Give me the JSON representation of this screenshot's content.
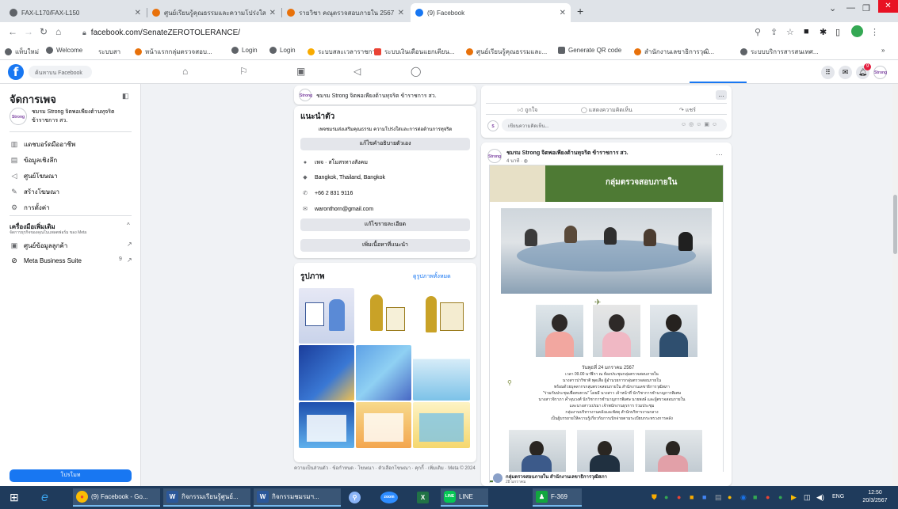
{
  "browser": {
    "tabs": [
      {
        "label": "FAX-L170/FAX-L150",
        "color": "#5f6368",
        "active": false
      },
      {
        "label": "ศูนย์เรียนรู้คุณธรรมและความโปร่งใส...",
        "color": "#e8710a",
        "active": false
      },
      {
        "label": "รายวิชา คณุตรวจสอบภายใน 2567",
        "color": "#e8710a",
        "active": false
      },
      {
        "label": "(9) Facebook",
        "color": "#1877f2",
        "active": true
      }
    ],
    "new_tab": "+",
    "url": "facebook.com/SenateZEROTOLERANCE/",
    "bookmarks": [
      {
        "label": "แท็บใหม่",
        "color": "#5f6368"
      },
      {
        "label": "Welcome",
        "color": "#5f6368"
      },
      {
        "label": "ระบบสา",
        "color": "#9aa0a6"
      },
      {
        "label": "หน้าแรกกลุ่มตรวจสอบ...",
        "color": "#e8710a"
      },
      {
        "label": "Login",
        "color": "#5f6368"
      },
      {
        "label": "Login",
        "color": "#5f6368"
      },
      {
        "label": "ระบบสละเวลาราชการ",
        "color": "#f9ab00"
      },
      {
        "label": "ระบบเงินเดือนแยกเตียน...",
        "color": "#ea4335"
      },
      {
        "label": "ศูนย์เรียนรู้คุณธรรมและ...",
        "color": "#e8710a"
      },
      {
        "label": "Generate QR code",
        "color": "#5f6368"
      },
      {
        "label": "สำนักงานเลขาธิการวุฒิ...",
        "color": "#e8710a"
      },
      {
        "label": "ระบบบริการสารสนเทศ...",
        "color": "#5f6368"
      }
    ],
    "more_bookmarks": "»"
  },
  "facebook": {
    "search_placeholder": "ค้นหาบน Facebook",
    "notif_count": "9",
    "sidebar": {
      "title": "จัดการเพจ",
      "page_name": "ชมรม Strong จิตพอเพียงต้านทุจริต ข้าราชการ สว.",
      "items": [
        {
          "label": "แดชบอร์ดมืออาชีพ",
          "icon": "dashboard-icon"
        },
        {
          "label": "ข้อมูลเชิงลึก",
          "icon": "insights-icon"
        },
        {
          "label": "ศูนย์โฆษณา",
          "icon": "megaphone-icon"
        },
        {
          "label": "สร้างโฆษณา",
          "icon": "create-ad-icon"
        },
        {
          "label": "การตั้งค่า",
          "icon": "gear-icon"
        }
      ],
      "tools_title": "เครื่องมือเพิ่มเติม",
      "tools_subtitle": "จัดการธุรกิจของคุณในแพลตฟอร์ม ของ Meta",
      "tools": [
        {
          "label": "ศูนย์ข้อมูลลูกค้า",
          "icon": "contacts-icon",
          "badge": ""
        },
        {
          "label": "Meta Business Suite",
          "icon": "meta-icon",
          "badge": "9"
        }
      ],
      "promote": "โปรโมท"
    },
    "intro": {
      "page_name": "ชมรม Strong จิตพอเพียงต้านทุจริต ข้าราชการ สว.",
      "heading": "แนะนำตัว",
      "bio": "เพจชมรมส่งเสริมคุณธรรม ความโปร่งใสและการต่อต้านการทุจริต",
      "edit_bio": "แก้ไขคำอธิบายตัวเอง",
      "category": "เพจ · สโมสรทางสังคม",
      "location": "Bangkok, Thailand, Bangkok",
      "phone": "+66 2 831 9116",
      "email": "waronthorn@gmail.com",
      "edit_details": "แก้ไขรายละเอียด",
      "add_featured": "เพิ่มเนื้อหาที่แนะนำ"
    },
    "photos": {
      "heading": "รูปภาพ",
      "see_all": "ดูรูปภาพทั้งหมด",
      "footer": "ความเป็นส่วนตัว · ข้อกำหนด · โฆษณา · ตัวเลือกโฆษณา · คุกกี้ · เพิ่มเติม · Meta © 2024"
    },
    "composer": {
      "like": "ถูกใจ",
      "comment": "แสดงความคิดเห็น",
      "share": "แชร์",
      "placeholder": "เขียนความคิดเห็น..."
    },
    "post": {
      "author": "ชมรม Strong จิตพอเพียงต้านทุจริต ข้าราชการ สว.",
      "time": "4 นาที",
      "banner": "กลุ่มตรวจสอบภายใน",
      "caption_date": "วันพุธที่ 24 มกราคม 2567",
      "caption_lines": [
        "เวลา 09.00 นาฬิกา ณ ห้องประชุมกลุ่มตรวจสอบภายใน",
        "นางสาวปาริชาติ พุดเสือ ผู้อำนวยการกลุ่มตรวจสอบภายใน",
        "พร้อมด้วยบุคลากรกลุ่มตรวจสอบภายใน สำนักงานเลขาธิการวุฒิสภา",
        "\"ร่วมกันประชุมเพื่อทบทวน\" โดยมี นางสาว เจ้าหน้าที่ นักวิชาการชำนาญการพิเศษ",
        "นางสาวจิราภา ค้ำจุนวงศ์ นักวิชาการชำนาญการพิเศษ นายพงษ์ และผู้ตรวจสอบภายใน",
        "และนางสาวเปรมา เจ้าพนักงานธุรการ ร่วมประชุม",
        "กลุ่มงานบริหารงานคลังและพัสดุ สำนักบริหารงานกลาง",
        "เป็นผู้บรรยายให้ความรู้เกี่ยวกับการเบิกจ่ายตามระเบียบกระทรวงการคลัง"
      ]
    },
    "shared_from": {
      "name": "กลุ่มตรวจสอบภายใน สำนักงานเลขาธิการวุฒิสภา",
      "time": "28 มกราคม"
    }
  },
  "taskbar": {
    "items": [
      {
        "label": "(9) Facebook - Go...",
        "icon": "chrome-icon",
        "color": "#fbbc04"
      },
      {
        "label": "กิจกรรมเรียนรู้ศูนย์...",
        "icon": "word-icon",
        "color": "#2b579a"
      },
      {
        "label": "กิจกรรมชมรมฯ...",
        "icon": "word-icon",
        "color": "#2b579a"
      },
      {
        "label": "zoom",
        "icon": "zoom-icon",
        "color": "#2d8cff"
      },
      {
        "label": "LINE",
        "icon": "line-icon",
        "color": "#06c755"
      },
      {
        "label": "F-369",
        "icon": "app-icon",
        "color": "#12a63f"
      }
    ],
    "lang": "ENG",
    "time": "12:50",
    "date": "20/3/2567"
  }
}
